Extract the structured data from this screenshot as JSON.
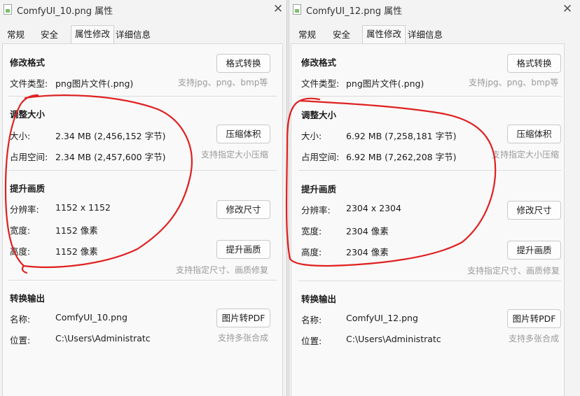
{
  "windows": [
    {
      "title": "ComfyUI_10.png 属性",
      "close_glyph": "✕",
      "tabs": [
        "常规",
        "安全",
        "属性修改",
        "详细信息"
      ],
      "active_tab": "属性修改",
      "format": {
        "heading": "修改格式",
        "type_label": "文件类型:",
        "type_value": "png图片文件(.png)",
        "button": "格式转换",
        "hint": "支持jpg、png、bmp等"
      },
      "size": {
        "heading": "调整大小",
        "size_label": "大小:",
        "size_value": "2.34 MB (2,456,152 字节)",
        "disk_label": "占用空间:",
        "disk_value": "2.34 MB (2,457,600 字节)",
        "button": "压缩体积",
        "hint": "支持指定大小压缩"
      },
      "quality": {
        "heading": "提升画质",
        "res_label": "分辨率:",
        "res_value": "1152 x 1152",
        "width_label": "宽度:",
        "width_value": "1152 像素",
        "height_label": "高度:",
        "height_value": "1152 像素",
        "resize_button": "修改尺寸",
        "enhance_button": "提升画质",
        "hint": "支持指定尺寸、画质修复"
      },
      "output": {
        "heading": "转换输出",
        "name_label": "名称:",
        "name_value": "ComfyUI_10.png",
        "loc_label": "位置:",
        "loc_value": "C:\\Users\\Administratc",
        "button": "图片转PDF",
        "hint": "支持多张合成"
      }
    },
    {
      "title": "ComfyUI_12.png 属性",
      "close_glyph": "✕",
      "tabs": [
        "常规",
        "安全",
        "属性修改",
        "详细信息"
      ],
      "active_tab": "属性修改",
      "format": {
        "heading": "修改格式",
        "type_label": "文件类型:",
        "type_value": "png图片文件(.png)",
        "button": "格式转换",
        "hint": "支持jpg、png、bmp等"
      },
      "size": {
        "heading": "调整大小",
        "size_label": "大小:",
        "size_value": "6.92 MB (7,258,181 字节)",
        "disk_label": "占用空间:",
        "disk_value": "6.92 MB (7,262,208 字节)",
        "button": "压缩体积",
        "hint": "支持指定大小压缩"
      },
      "quality": {
        "heading": "提升画质",
        "res_label": "分辨率:",
        "res_value": "2304 x 2304",
        "width_label": "宽度:",
        "width_value": "2304 像素",
        "height_label": "高度:",
        "height_value": "2304 像素",
        "resize_button": "修改尺寸",
        "enhance_button": "提升画质",
        "hint": "支持指定尺寸、画质修复"
      },
      "output": {
        "heading": "转换输出",
        "name_label": "名称:",
        "name_value": "ComfyUI_12.png",
        "loc_label": "位置:",
        "loc_value": "C:\\Users\\Administratc",
        "button": "图片转PDF",
        "hint": "支持多张合成"
      }
    }
  ],
  "annotation_color": "#e02020"
}
